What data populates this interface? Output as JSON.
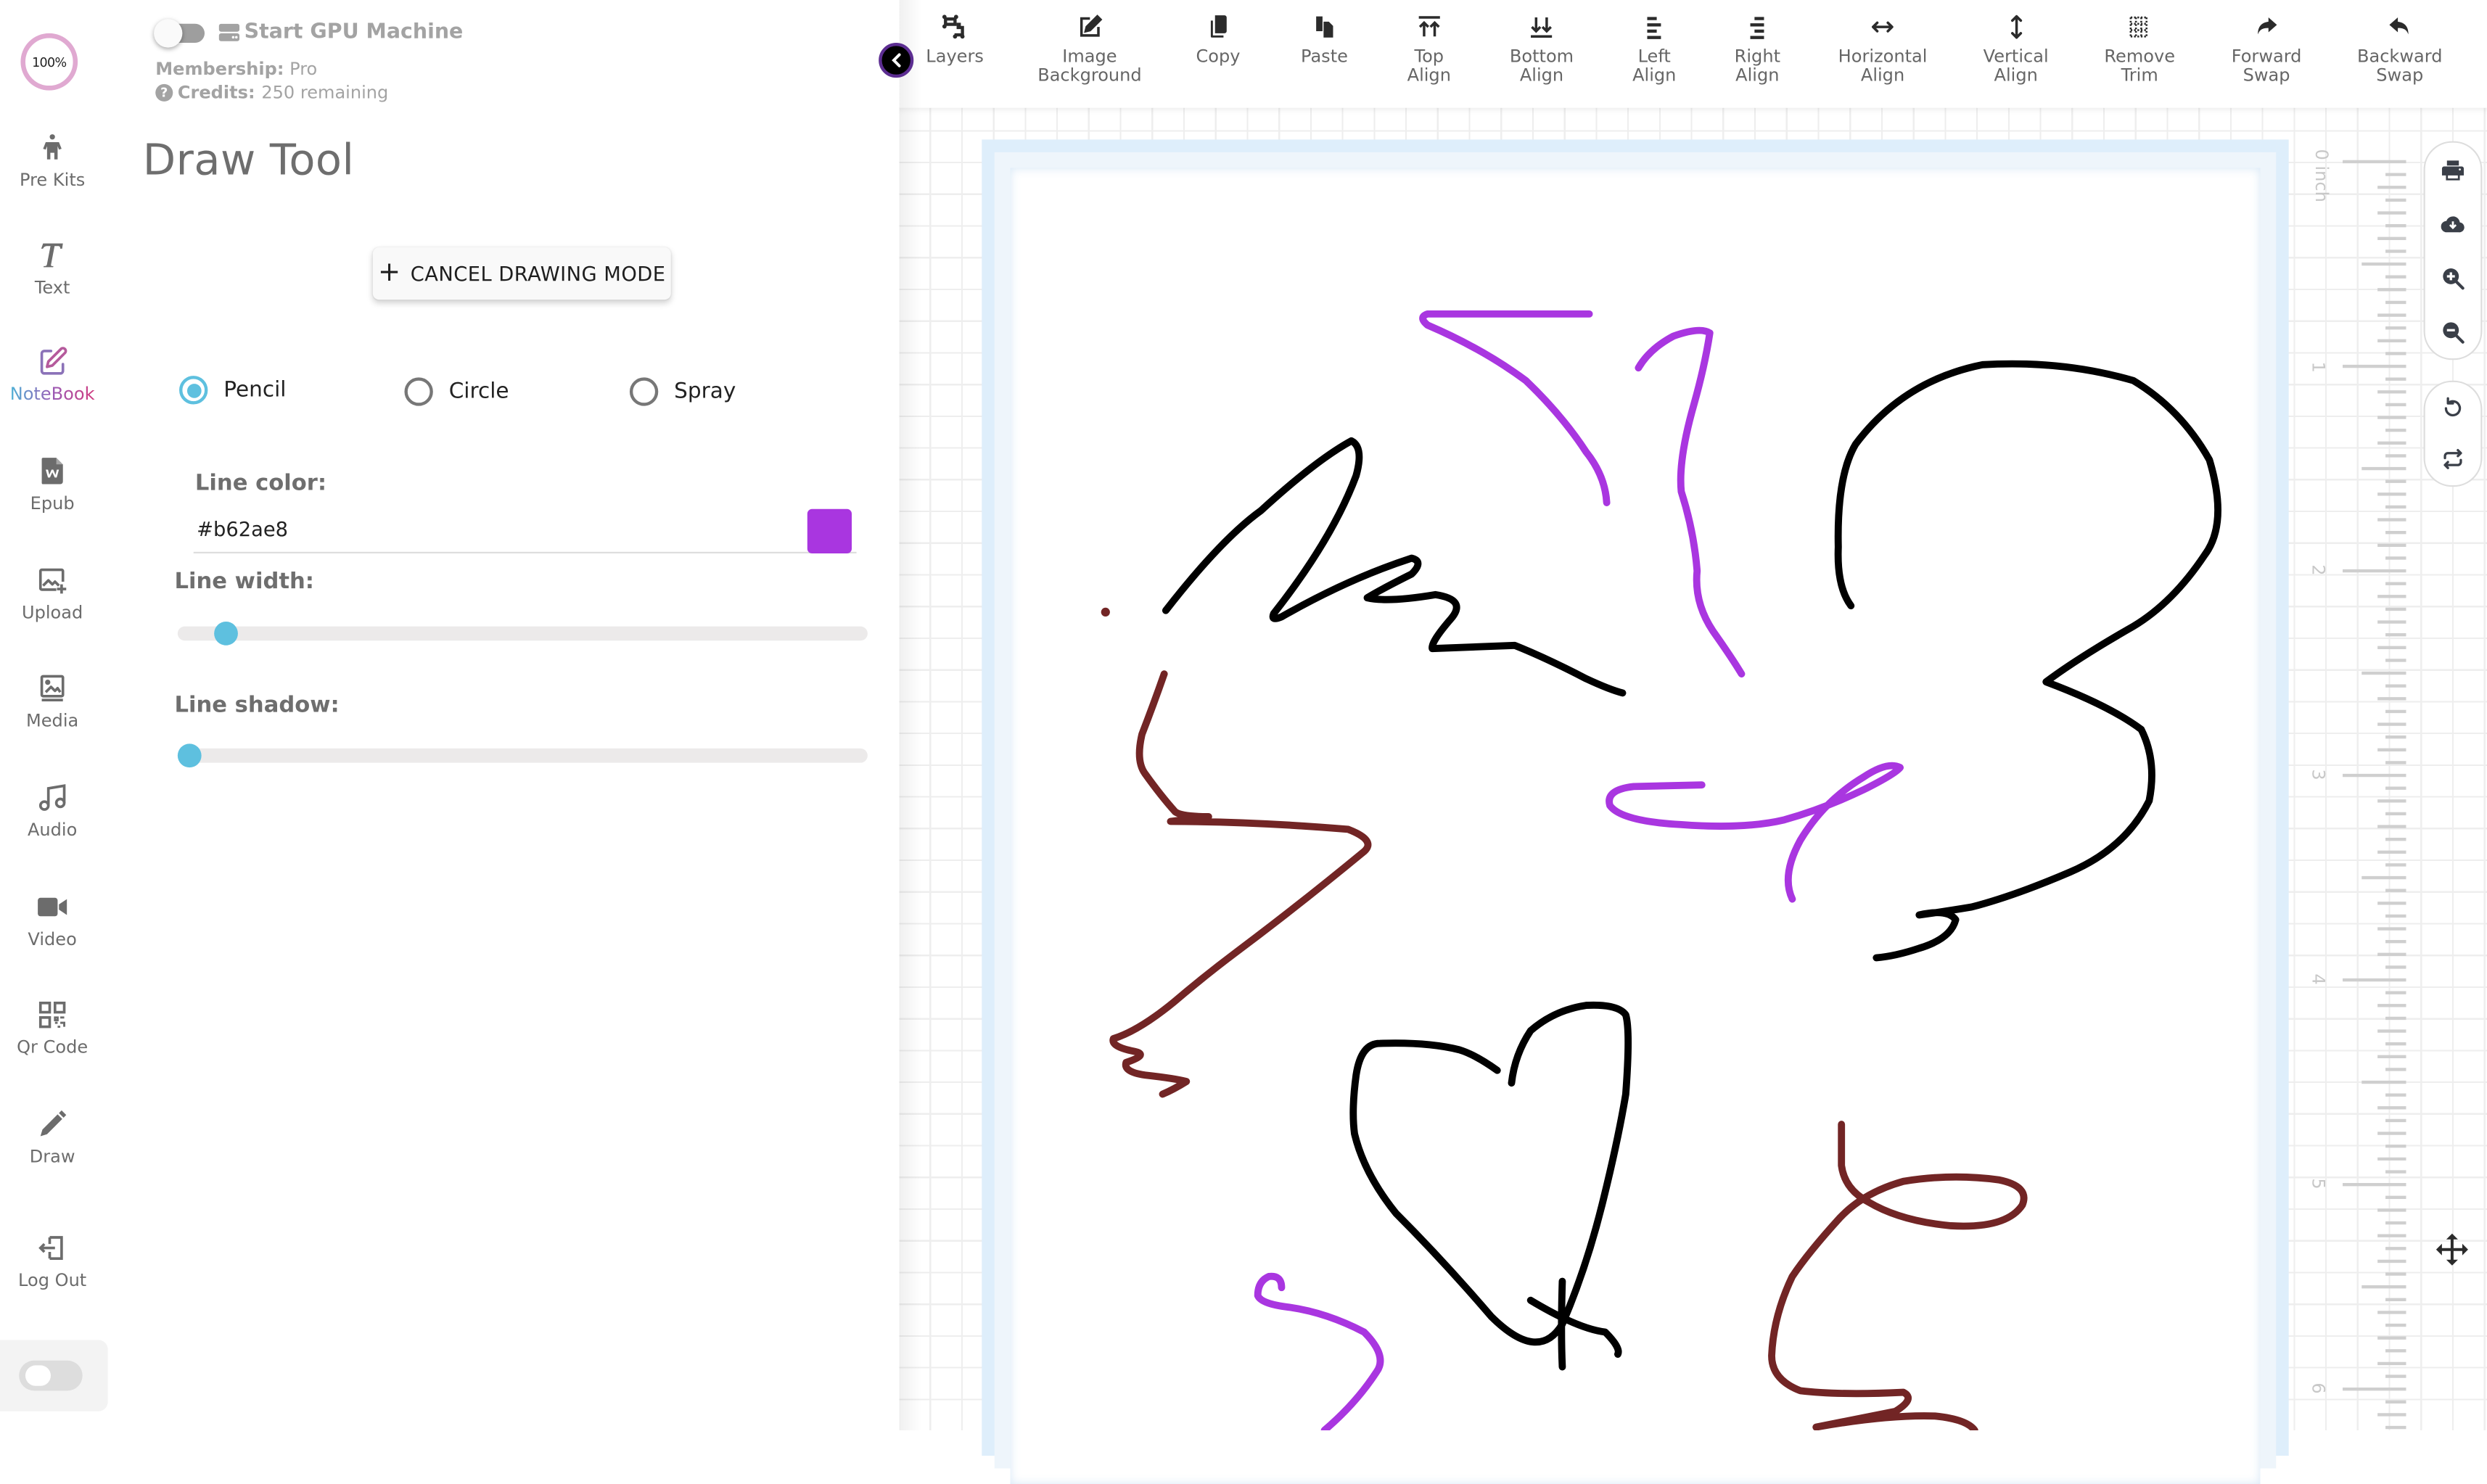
{
  "sidebar": {
    "progress_label": "100%",
    "progress_value": 100,
    "items": [
      {
        "label": "Pre Kits",
        "icon": "child-icon"
      },
      {
        "label": "Text",
        "icon": "text-icon"
      },
      {
        "label": "NoteBook",
        "icon": "notebook-edit-icon",
        "active": true
      },
      {
        "label": "Epub",
        "icon": "epub-file-icon"
      },
      {
        "label": "Upload",
        "icon": "image-upload-icon"
      },
      {
        "label": "Media",
        "icon": "media-icon"
      },
      {
        "label": "Audio",
        "icon": "music-note-icon"
      },
      {
        "label": "Video",
        "icon": "video-camera-icon"
      },
      {
        "label": "Qr Code",
        "icon": "qr-code-icon"
      },
      {
        "label": "Draw",
        "icon": "pencil-icon"
      },
      {
        "label": "Log Out",
        "icon": "logout-icon"
      }
    ],
    "theme_toggle_on": false
  },
  "panel": {
    "gpu_toggle_on": false,
    "gpu_label": "Start GPU Machine",
    "membership_label": "Membership:",
    "membership_value": "Pro",
    "credits_label": "Credits:",
    "credits_value": "250 remaining",
    "title": "Draw Tool",
    "cancel_button": "CANCEL DRAWING MODE",
    "brush_options": [
      {
        "label": "Pencil",
        "checked": true
      },
      {
        "label": "Circle",
        "checked": false
      },
      {
        "label": "Spray",
        "checked": false
      }
    ],
    "line_color_label": "Line color:",
    "line_color_value": "#b62ae8",
    "line_color_swatch": "#a936e0",
    "line_width_label": "Line width:",
    "line_width_fraction": 0.07,
    "line_shadow_label": "Line shadow:",
    "line_shadow_fraction": 0.0
  },
  "toolbar": {
    "items": [
      {
        "label": "Layers",
        "icon": "layers-icon"
      },
      {
        "label": "Image\nBackground",
        "icon": "edit-image-icon"
      },
      {
        "label": "Copy",
        "icon": "copy-icon"
      },
      {
        "label": "Paste",
        "icon": "paste-icon"
      },
      {
        "label": "Top\nAlign",
        "icon": "align-top-icon"
      },
      {
        "label": "Bottom\nAlign",
        "icon": "align-bottom-icon"
      },
      {
        "label": "Left\nAlign",
        "icon": "align-left-icon"
      },
      {
        "label": "Right\nAlign",
        "icon": "align-right-icon"
      },
      {
        "label": "Horizontal\nAlign",
        "icon": "horizontal-align-icon"
      },
      {
        "label": "Vertical\nAlign",
        "icon": "vertical-align-icon"
      },
      {
        "label": "Remove\nTrim",
        "icon": "remove-trim-icon"
      },
      {
        "label": "Forward\nSwap",
        "icon": "forward-swap-icon"
      },
      {
        "label": "Backward\nSwap",
        "icon": "backward-swap-icon"
      }
    ]
  },
  "ruler": {
    "unit_label": "0 inch",
    "marks": [
      "1",
      "2",
      "3",
      "4",
      "5",
      "6"
    ]
  },
  "canvas": {
    "stroke_colors": {
      "black": "#000000",
      "purple": "#a936e0",
      "brown": "#722525"
    }
  }
}
